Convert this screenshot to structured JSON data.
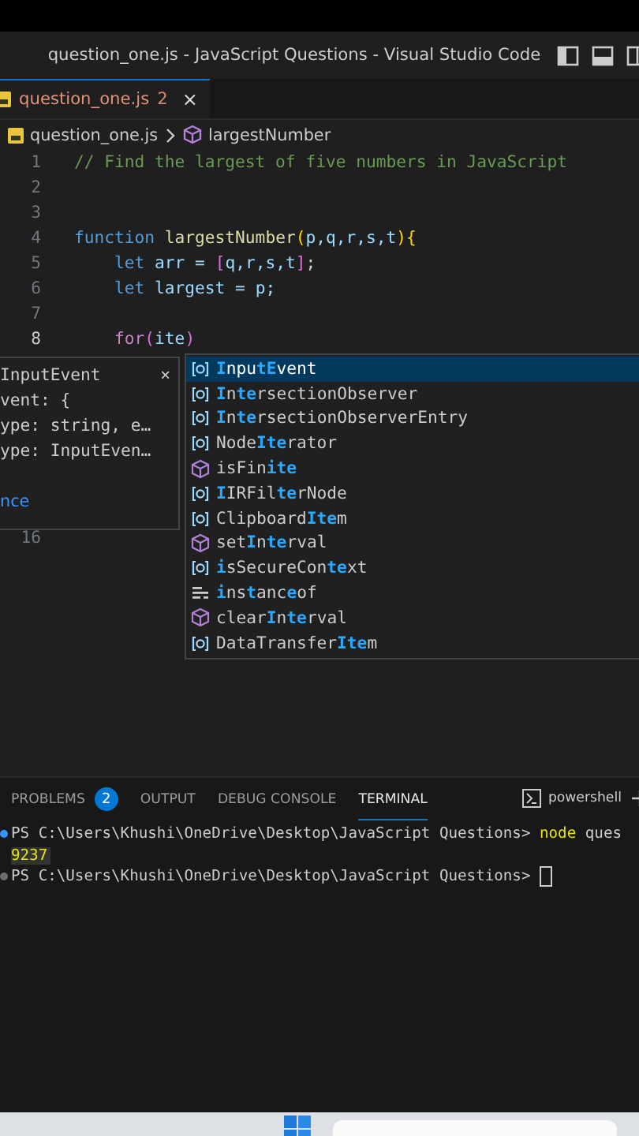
{
  "window": {
    "title": "question_one.js - JavaScript Questions - Visual Studio Code"
  },
  "tabs": [
    {
      "label": "question_one.js",
      "problems": "2",
      "close": "×",
      "selected": true
    }
  ],
  "breadcrumb": [
    {
      "label": "question_one.js",
      "kind": "file"
    },
    {
      "label": "largestNumber",
      "kind": "function"
    }
  ],
  "editor": {
    "lines": [
      {
        "number": "1",
        "tokens": [
          {
            "text": "// Find the largest of five numbers in JavaScript",
            "kind": "comment"
          }
        ]
      },
      {
        "number": "2"
      },
      {
        "number": "3"
      },
      {
        "number": "4",
        "tokens": [
          {
            "text": "function",
            "kind": "keyword"
          },
          {
            "text": " largestNumber",
            "kind": "func"
          },
          {
            "text": "(",
            "kind": "bracket1"
          },
          {
            "text": "p,q,r,s,t",
            "kind": "param"
          },
          {
            "text": ")",
            "kind": "bracket1"
          },
          {
            "text": "{",
            "kind": "bracket1"
          }
        ]
      },
      {
        "number": "5",
        "tokens": [
          {
            "text": "    let",
            "kind": "keyword"
          },
          {
            "text": " arr = ",
            "kind": "param"
          },
          {
            "text": "[",
            "kind": "bracket2"
          },
          {
            "text": "q,r,s,t",
            "kind": "param"
          },
          {
            "text": "]",
            "kind": "bracket2"
          },
          {
            "text": ";",
            "kind": "plain"
          }
        ]
      },
      {
        "number": "6",
        "tokens": [
          {
            "text": "    let",
            "kind": "keyword"
          },
          {
            "text": " largest = p;",
            "kind": "param"
          }
        ]
      },
      {
        "number": "7"
      },
      {
        "number": "8",
        "tokens": [
          {
            "text": "    for",
            "kind": "control"
          },
          {
            "text": "(",
            "kind": "bracket2"
          },
          {
            "text": "ite",
            "kind": "param"
          },
          {
            "text": ")",
            "kind": "bracket2"
          }
        ]
      }
    ],
    "number_below_hover": "16"
  },
  "hover": {
    "title": "InputEvent",
    "close": "×",
    "lines": [
      "vent: {",
      "ype: string, e…",
      "ype: InputEven…"
    ],
    "link": "nce"
  },
  "suggestions": [
    {
      "kind": "class",
      "selected": true,
      "parts": [
        {
          "text": "I",
          "match": true
        },
        {
          "text": "npu",
          "match": false
        },
        {
          "text": "tE",
          "match": true
        },
        {
          "text": "vent",
          "match": false
        }
      ]
    },
    {
      "kind": "class",
      "selected": false,
      "parts": [
        {
          "text": "I",
          "match": true
        },
        {
          "text": "n",
          "match": false
        },
        {
          "text": "te",
          "match": true
        },
        {
          "text": "rsectionObserver",
          "match": false
        }
      ]
    },
    {
      "kind": "class",
      "selected": false,
      "parts": [
        {
          "text": "I",
          "match": true
        },
        {
          "text": "n",
          "match": false
        },
        {
          "text": "te",
          "match": true
        },
        {
          "text": "rsectionObserverEntry",
          "match": false
        }
      ]
    },
    {
      "kind": "class",
      "selected": false,
      "parts": [
        {
          "text": "Node",
          "match": false
        },
        {
          "text": "Ite",
          "match": true
        },
        {
          "text": "rator",
          "match": false
        }
      ]
    },
    {
      "kind": "function",
      "selected": false,
      "parts": [
        {
          "text": "isFin",
          "match": false
        },
        {
          "text": "ite",
          "match": true
        }
      ]
    },
    {
      "kind": "class",
      "selected": false,
      "parts": [
        {
          "text": "I",
          "match": true
        },
        {
          "text": "IRFil",
          "match": false
        },
        {
          "text": "te",
          "match": true
        },
        {
          "text": "rNode",
          "match": false
        }
      ]
    },
    {
      "kind": "class",
      "selected": false,
      "parts": [
        {
          "text": "Clipboard",
          "match": false
        },
        {
          "text": "Ite",
          "match": true
        },
        {
          "text": "m",
          "match": false
        }
      ]
    },
    {
      "kind": "function",
      "selected": false,
      "parts": [
        {
          "text": "set",
          "match": false
        },
        {
          "text": "I",
          "match": true
        },
        {
          "text": "n",
          "match": false
        },
        {
          "text": "te",
          "match": true
        },
        {
          "text": "rval",
          "match": false
        }
      ]
    },
    {
      "kind": "class",
      "selected": false,
      "parts": [
        {
          "text": "i",
          "match": true
        },
        {
          "text": "sSecureCon",
          "match": false
        },
        {
          "text": "te",
          "match": true
        },
        {
          "text": "xt",
          "match": false
        }
      ]
    },
    {
      "kind": "keyword",
      "selected": false,
      "parts": [
        {
          "text": "i",
          "match": true
        },
        {
          "text": "ns",
          "match": false
        },
        {
          "text": "t",
          "match": true
        },
        {
          "text": "anc",
          "match": false
        },
        {
          "text": "e",
          "match": true
        },
        {
          "text": "of",
          "match": false
        }
      ]
    },
    {
      "kind": "function",
      "selected": false,
      "parts": [
        {
          "text": "clear",
          "match": false
        },
        {
          "text": "I",
          "match": true
        },
        {
          "text": "n",
          "match": false
        },
        {
          "text": "te",
          "match": true
        },
        {
          "text": "rval",
          "match": false
        }
      ]
    },
    {
      "kind": "class",
      "selected": false,
      "parts": [
        {
          "text": "DataTransfer",
          "match": false
        },
        {
          "text": "Ite",
          "match": true
        },
        {
          "text": "m",
          "match": false
        }
      ]
    }
  ],
  "panel": {
    "tabs": [
      {
        "label": "PROBLEMS",
        "badge": "2",
        "selected": false
      },
      {
        "label": "OUTPUT",
        "selected": false
      },
      {
        "label": "DEBUG CONSOLE",
        "selected": false
      },
      {
        "label": "TERMINAL",
        "selected": true
      }
    ],
    "shell": "powershell",
    "terminal": [
      {
        "kind": "prompt",
        "text": "PS C:\\Users\\Khushi\\OneDrive\\Desktop\\JavaScript Questions>",
        "command": "node",
        "args": "ques"
      },
      {
        "kind": "output",
        "text": "9237"
      },
      {
        "kind": "prompt",
        "text": "PS C:\\Users\\Khushi\\OneDrive\\Desktop\\JavaScript Questions>",
        "cursor": true
      }
    ]
  }
}
